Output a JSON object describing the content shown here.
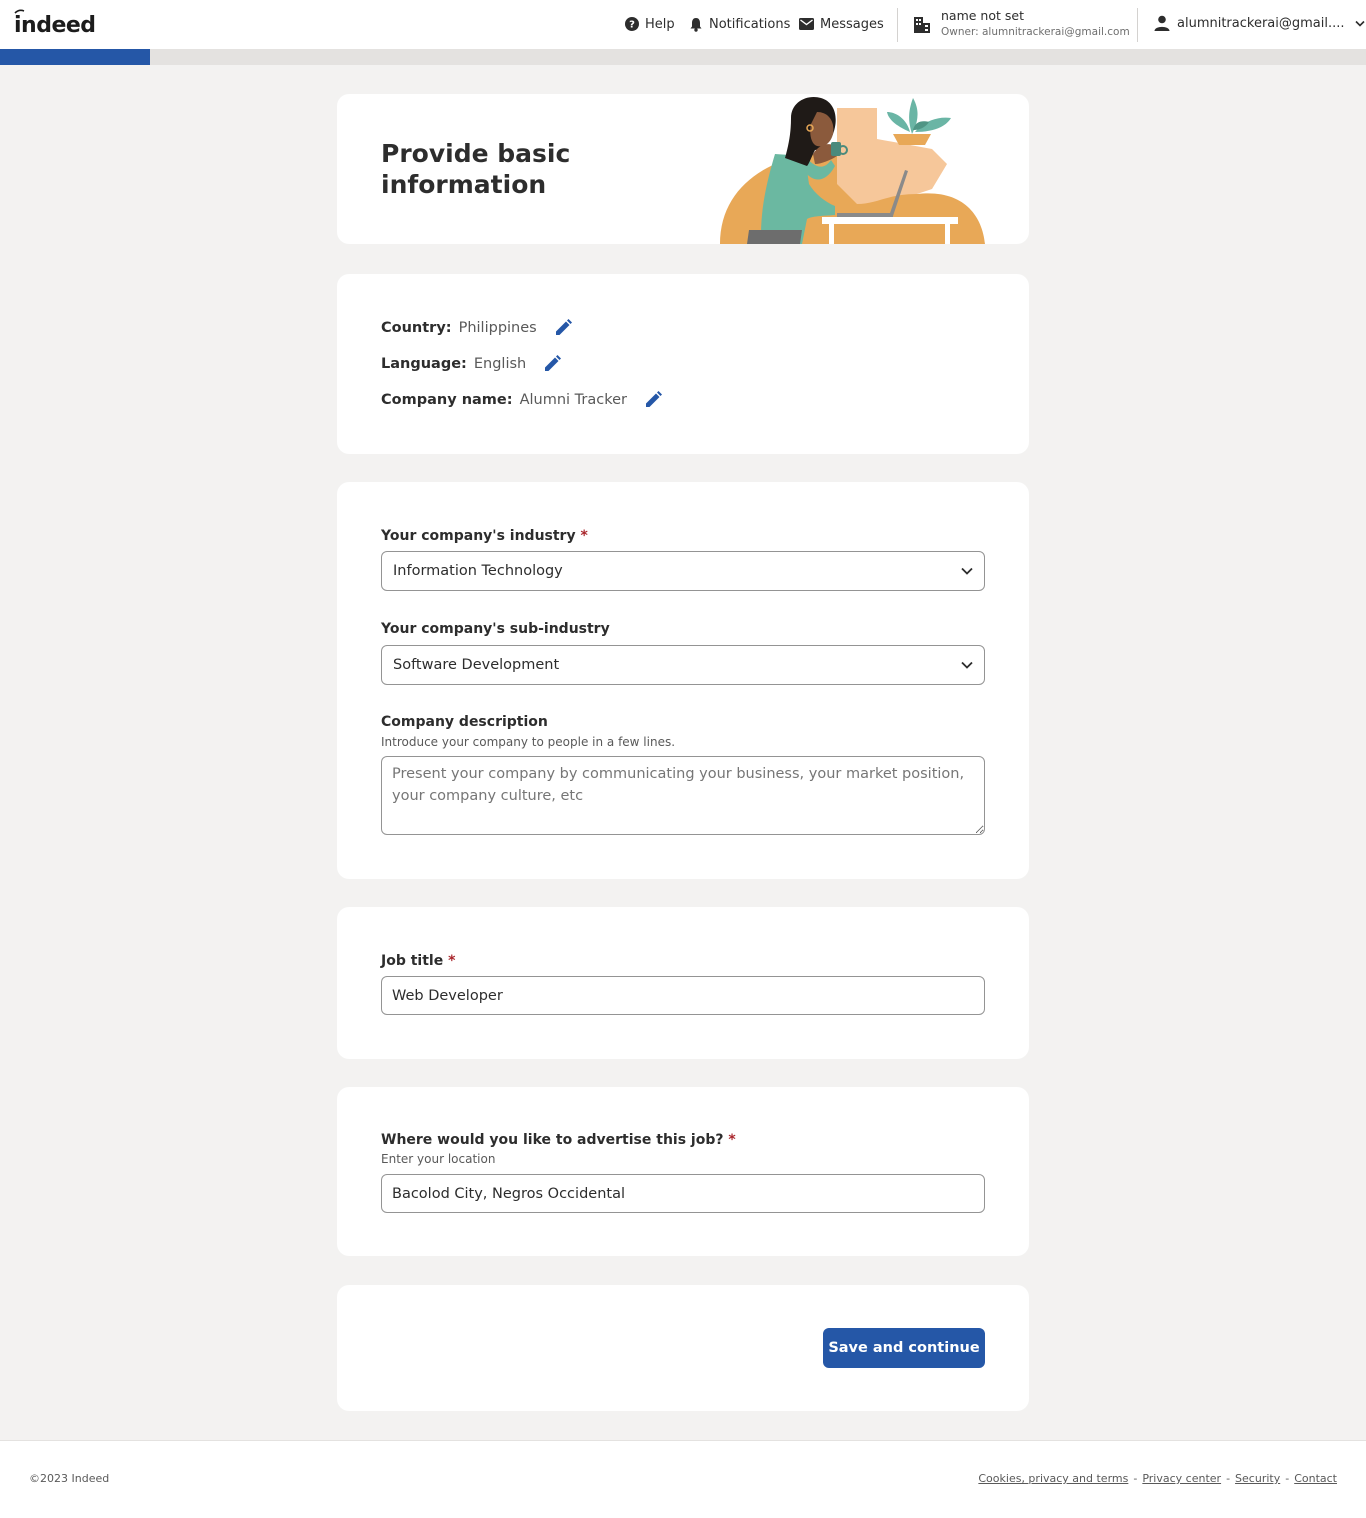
{
  "header": {
    "logo_text": "indeed",
    "nav": {
      "help": "Help",
      "notifications": "Notifications",
      "messages": "Messages"
    },
    "company": {
      "name": "name not set",
      "owner": "Owner: alumnitrackerai@gmail.com"
    },
    "account": "alumnitrackerai@gmail...."
  },
  "progress": {
    "fraction": 0.11
  },
  "hero": {
    "title": "Provide basic information"
  },
  "basics": {
    "country": {
      "label": "Country:",
      "value": "Philippines"
    },
    "language": {
      "label": "Language:",
      "value": "English"
    },
    "company_name": {
      "label": "Company name:",
      "value": "Alumni Tracker"
    }
  },
  "industry": {
    "label": "Your company's industry",
    "required": "*",
    "value": "Information Technology"
  },
  "sub_industry": {
    "label": "Your company's sub-industry",
    "value": "Software Development"
  },
  "description": {
    "label": "Company description",
    "help": "Introduce your company to people in a few lines.",
    "placeholder": "Present your company by communicating your business, your market position, your company culture, etc",
    "value": ""
  },
  "job_title": {
    "label": "Job title",
    "required": "*",
    "value": "Web Developer"
  },
  "location": {
    "label": "Where would you like to advertise this job?",
    "required": "*",
    "help": "Enter your location",
    "value": "Bacolod City, Negros Occidental"
  },
  "actions": {
    "save": "Save and continue"
  },
  "footer": {
    "copyright": "©2023 Indeed",
    "links": [
      "Cookies, privacy and terms",
      "Privacy center",
      "Security",
      "Contact"
    ],
    "separator": "-"
  },
  "colors": {
    "accent": "#2557a7",
    "required": "#a9252b",
    "background": "#f3f2f1"
  }
}
